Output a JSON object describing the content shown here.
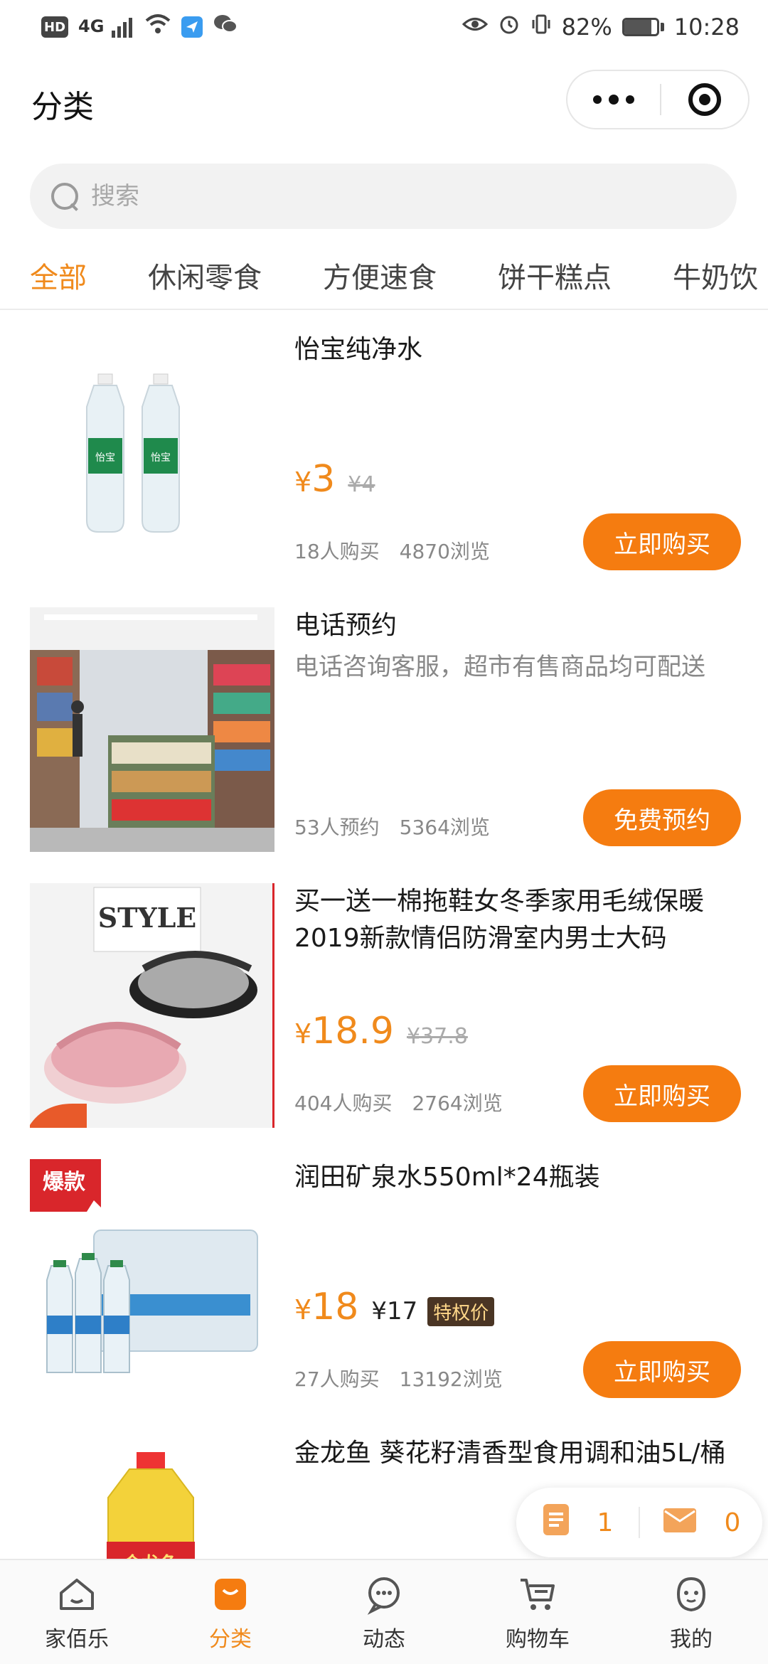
{
  "status_bar": {
    "left_icons": [
      "hd-icon",
      "4g-signal-icon",
      "wifi-icon",
      "app-notification-icon",
      "wechat-icon"
    ],
    "hd": "HD",
    "net": "4G",
    "battery_percent": "82%",
    "battery_level": 0.82,
    "time": "10:28"
  },
  "header": {
    "title": "分类"
  },
  "search": {
    "placeholder": "搜索"
  },
  "tabs": [
    {
      "label": "全部",
      "active": true
    },
    {
      "label": "休闲零食",
      "active": false
    },
    {
      "label": "方便速食",
      "active": false
    },
    {
      "label": "饼干糕点",
      "active": false
    },
    {
      "label": "牛奶饮",
      "active": false
    }
  ],
  "products": [
    {
      "title": "怡宝纯净水",
      "subtitle": "",
      "price_currency": "¥",
      "price": "3",
      "old_price": "¥4",
      "member_price": "",
      "badge": "",
      "stat1": "18人购买",
      "stat2": "4870浏览",
      "button": "立即购买",
      "image": "water-bottles-image"
    },
    {
      "title": "电话预约",
      "subtitle": "电话咨询客服，超市有售商品均可配送",
      "price_currency": "",
      "price": "",
      "old_price": "",
      "member_price": "",
      "badge": "",
      "stat1": "53人预约",
      "stat2": "5364浏览",
      "button": "免费预约",
      "image": "supermarket-image"
    },
    {
      "title": "买一送一棉拖鞋女冬季家用毛绒保暖2019新款情侣防滑室内男士大码",
      "subtitle": "",
      "price_currency": "¥",
      "price": "18.9",
      "old_price": "¥37.8",
      "member_price": "",
      "badge": "",
      "stat1": "404人购买",
      "stat2": "2764浏览",
      "button": "立即购买",
      "image": "slippers-image"
    },
    {
      "title": "润田矿泉水550ml*24瓶装",
      "subtitle": "",
      "price_currency": "¥",
      "price": "18",
      "old_price": "",
      "member_price": "¥17",
      "badge": "特权价",
      "tag": "爆款",
      "stat1": "27人购买",
      "stat2": "13192浏览",
      "button": "立即购买",
      "image": "water-pack-image"
    },
    {
      "title": "金龙鱼 葵花籽清香型食用调和油5L/桶",
      "subtitle": "",
      "image": "oil-bottle-image"
    }
  ],
  "float_bar": {
    "orders_count": "1",
    "messages_count": "0"
  },
  "tabbar": [
    {
      "label": "家佰乐",
      "icon": "home-icon",
      "active": false
    },
    {
      "label": "分类",
      "icon": "category-bag-icon",
      "active": true
    },
    {
      "label": "动态",
      "icon": "chat-bubble-icon",
      "active": false
    },
    {
      "label": "购物车",
      "icon": "cart-icon",
      "active": false
    },
    {
      "label": "我的",
      "icon": "profile-icon",
      "active": false
    }
  ],
  "colors": {
    "accent": "#f57c10",
    "price": "#f08a1c",
    "tag_red": "#d9262b"
  }
}
